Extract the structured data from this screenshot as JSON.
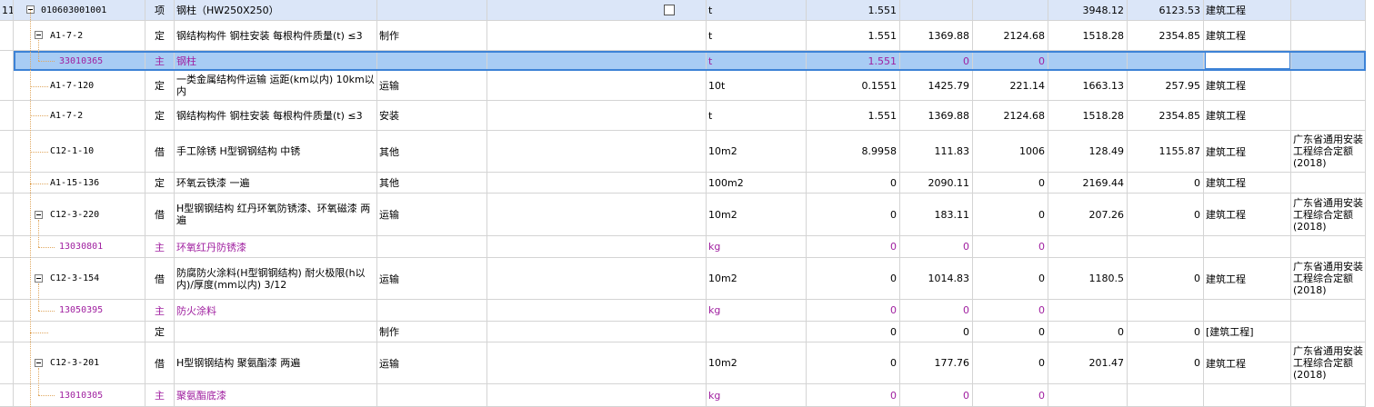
{
  "rows": [
    {
      "index": "11",
      "code": "010603001001",
      "type": "项",
      "name": "钢柱（HW250X250）",
      "feature": "",
      "unit": "t",
      "qty": "1.551",
      "price": "",
      "amount": "",
      "p1": "3948.12",
      "p2": "6123.53",
      "speciality": "建筑工程",
      "quota": "",
      "has_checkbox": true
    },
    {
      "index": "",
      "code": "A1-7-2",
      "type": "定",
      "name": "钢结构构件 钢柱安装 每根构件质量(t) ≤3",
      "feature": "制作",
      "unit": "t",
      "qty": "1.551",
      "price": "1369.88",
      "amount": "2124.68",
      "p1": "1518.28",
      "p2": "2354.85",
      "speciality": "建筑工程",
      "quota": ""
    },
    {
      "index": "",
      "code": "33010365",
      "type": "主",
      "name": "钢柱",
      "feature": "",
      "unit": "t",
      "qty": "1.551",
      "price": "0",
      "amount": "0",
      "p1": "",
      "p2": "",
      "speciality": "",
      "quota": ""
    },
    {
      "index": "",
      "code": "A1-7-120",
      "type": "定",
      "name": "一类金属结构件运输 运距(km以内) 10km以内",
      "feature": "运输",
      "unit": "10t",
      "qty": "0.1551",
      "price": "1425.79",
      "amount": "221.14",
      "p1": "1663.13",
      "p2": "257.95",
      "speciality": "建筑工程",
      "quota": ""
    },
    {
      "index": "",
      "code": "A1-7-2",
      "type": "定",
      "name": "钢结构构件 钢柱安装 每根构件质量(t) ≤3",
      "feature": "安装",
      "unit": "t",
      "qty": "1.551",
      "price": "1369.88",
      "amount": "2124.68",
      "p1": "1518.28",
      "p2": "2354.85",
      "speciality": "建筑工程",
      "quota": ""
    },
    {
      "index": "",
      "code": "C12-1-10",
      "type": "借",
      "name": "手工除锈 H型钢钢结构 中锈",
      "feature": "其他",
      "unit": "10m2",
      "qty": "8.9958",
      "price": "111.83",
      "amount": "1006",
      "p1": "128.49",
      "p2": "1155.87",
      "speciality": "建筑工程",
      "quota": "广东省通用安装工程综合定额(2018)"
    },
    {
      "index": "",
      "code": "A1-15-136",
      "type": "定",
      "name": "环氧云铁漆 一遍",
      "feature": "其他",
      "unit": "100m2",
      "qty": "0",
      "price": "2090.11",
      "amount": "0",
      "p1": "2169.44",
      "p2": "0",
      "speciality": "建筑工程",
      "quota": ""
    },
    {
      "index": "",
      "code": "C12-3-220",
      "type": "借",
      "name": "H型钢钢结构 红丹环氧防锈漆、环氧磁漆 两遍",
      "feature": "运输",
      "unit": "10m2",
      "qty": "0",
      "price": "183.11",
      "amount": "0",
      "p1": "207.26",
      "p2": "0",
      "speciality": "建筑工程",
      "quota": "广东省通用安装工程综合定额(2018)"
    },
    {
      "index": "",
      "code": "13030801",
      "type": "主",
      "name": "环氧红丹防锈漆",
      "feature": "",
      "unit": "kg",
      "qty": "0",
      "price": "0",
      "amount": "0",
      "p1": "",
      "p2": "",
      "speciality": "",
      "quota": ""
    },
    {
      "index": "",
      "code": "C12-3-154",
      "type": "借",
      "name": "防腐防火涂料(H型钢钢结构) 耐火极限(h以内)/厚度(mm以内) 3/12",
      "feature": "运输",
      "unit": "10m2",
      "qty": "0",
      "price": "1014.83",
      "amount": "0",
      "p1": "1180.5",
      "p2": "0",
      "speciality": "建筑工程",
      "quota": "广东省通用安装工程综合定额(2018)"
    },
    {
      "index": "",
      "code": "13050395",
      "type": "主",
      "name": "防火涂料",
      "feature": "",
      "unit": "kg",
      "qty": "0",
      "price": "0",
      "amount": "0",
      "p1": "",
      "p2": "",
      "speciality": "",
      "quota": ""
    },
    {
      "index": "",
      "code": "",
      "type": "定",
      "name": "",
      "feature": "制作",
      "unit": "",
      "qty": "0",
      "price": "0",
      "amount": "0",
      "p1": "0",
      "p2": "0",
      "speciality": "[建筑工程]",
      "quota": ""
    },
    {
      "index": "",
      "code": "C12-3-201",
      "type": "借",
      "name": "H型钢钢结构 聚氨酯漆 两遍",
      "feature": "运输",
      "unit": "10m2",
      "qty": "0",
      "price": "177.76",
      "amount": "0",
      "p1": "201.47",
      "p2": "0",
      "speciality": "建筑工程",
      "quota": "广东省通用安装工程综合定额(2018)"
    },
    {
      "index": "",
      "code": "13010305",
      "type": "主",
      "name": "聚氨酯底漆",
      "feature": "",
      "unit": "kg",
      "qty": "0",
      "price": "0",
      "amount": "0",
      "p1": "",
      "p2": "",
      "speciality": "",
      "quota": ""
    }
  ]
}
